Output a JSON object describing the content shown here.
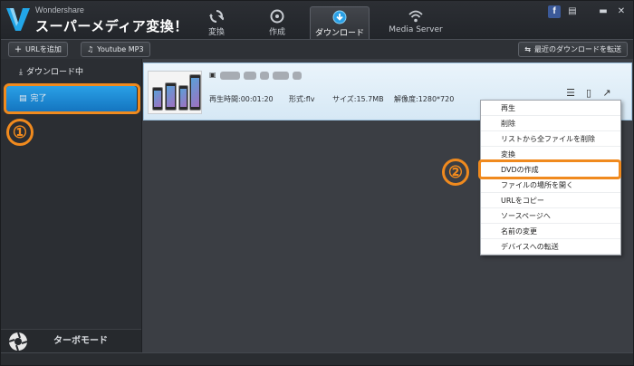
{
  "app": {
    "brand_small": "Wondershare",
    "brand_name": "スーパーメディア変換！"
  },
  "tabs": [
    {
      "label": "変換",
      "icon": "convert-icon"
    },
    {
      "label": "作成",
      "icon": "burn-disc-icon"
    },
    {
      "label": "ダウンロード",
      "icon": "download-icon",
      "active": true
    },
    {
      "label": "Media Server",
      "icon": "wifi-icon"
    }
  ],
  "toolbar": {
    "add_url": "URLを追加",
    "youtube_mp3": "Youtube MP3",
    "transfer_recent": "最近のダウンロードを転送"
  },
  "sidebar": {
    "downloading": "ダウンロード中",
    "completed": "完了",
    "turbo": "ターボモード"
  },
  "file": {
    "duration": "再生時間:00:01:20",
    "format": "形式:flv",
    "size": "サイズ:15.7MB",
    "resolution": "解像度:1280*720"
  },
  "context_menu": [
    "再生",
    "削除",
    "リストから全ファイルを削除",
    "変換",
    "DVDの作成",
    "ファイルの場所を開く",
    "URLをコピー",
    "ソースページへ",
    "名前の変更",
    "デバイスへの転送"
  ],
  "annotations": {
    "step1": "①",
    "step2": "②"
  },
  "colors": {
    "accent_highlight": "#f08a1e",
    "selected_item": "#1e8ad6",
    "file_row": "#dcecf8"
  }
}
